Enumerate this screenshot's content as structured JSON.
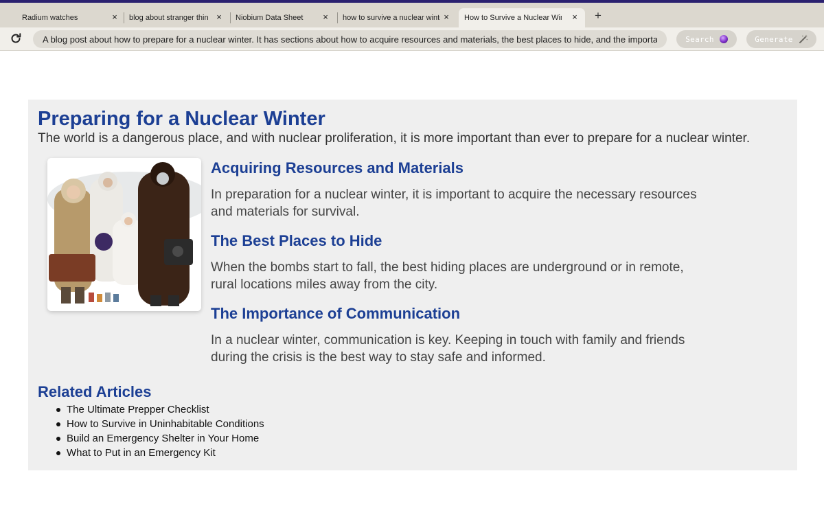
{
  "browser": {
    "tabs": [
      {
        "label": "Radium watches",
        "active": false
      },
      {
        "label": "blog about stranger things",
        "active": false
      },
      {
        "label": "Niobium Data Sheet",
        "active": false
      },
      {
        "label": "how to survive a nuclear winter",
        "active": false
      },
      {
        "label": "How to Survive a Nuclear Winter",
        "active": true
      }
    ],
    "new_tab_label": "+",
    "close_glyph": "×",
    "address_text": "A blog post about how to prepare for a nuclear winter. It has sections about how to acquire resources and materials, the best places to hide, and the importance of communication",
    "search_button": "Search",
    "generate_button": "Generate",
    "colors": {
      "accent": "#1c3f94",
      "top_bar": "#2b2170"
    }
  },
  "page": {
    "title": "Preparing for a Nuclear Winter",
    "intro": "The world is a dangerous place, and with nuclear proliferation, it is more important than ever to prepare for a nuclear winter.",
    "sections": [
      {
        "heading": "Acquiring Resources and Materials",
        "body": "In preparation for a nuclear winter, it is important to acquire the necessary resources and materials for survival."
      },
      {
        "heading": "The Best Places to Hide",
        "body": "When the bombs start to fall, the best hiding places are underground or in remote, rural locations miles away from the city."
      },
      {
        "heading": "The Importance of Communication",
        "body": "In a nuclear winter, communication is key. Keeping in touch with family and friends during the crisis is the best way to stay safe and informed."
      }
    ],
    "related_title": "Related Articles",
    "related": [
      "The Ultimate Prepper Checklist",
      "How to Survive in Uninhabitable Conditions",
      "Build an Emergency Shelter in Your Home",
      "What to Put in an Emergency Kit"
    ]
  }
}
